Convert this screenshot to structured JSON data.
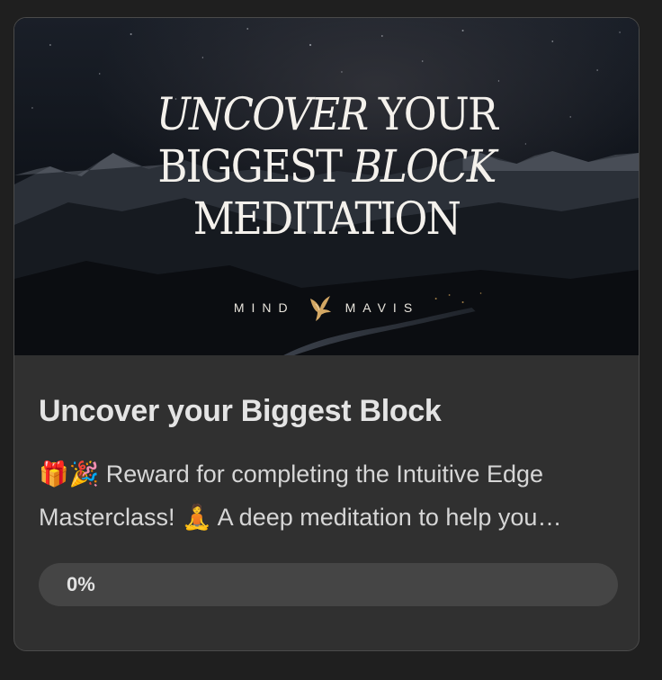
{
  "hero": {
    "title_line1_italic": "UNCOVER",
    "title_line1_rest": " YOUR",
    "title_line2_start": "BIGGEST ",
    "title_line2_italic": "BLOCK",
    "title_line3": "MEDITATION",
    "brand_left": "MIND",
    "brand_right": "MAVIS",
    "brand_icon": "hummingbird-icon"
  },
  "card": {
    "title": "Uncover your Biggest Block",
    "description": "🎁🎉 Reward for completing the Intuitive Edge Masterclass! 🧘 A deep meditation to help you uncover the biggest block holding you back.",
    "progress_label": "0%",
    "progress_value": 0
  },
  "colors": {
    "page_bg": "#1f1f1f",
    "card_bg": "#303030",
    "progress_track": "#454545"
  }
}
